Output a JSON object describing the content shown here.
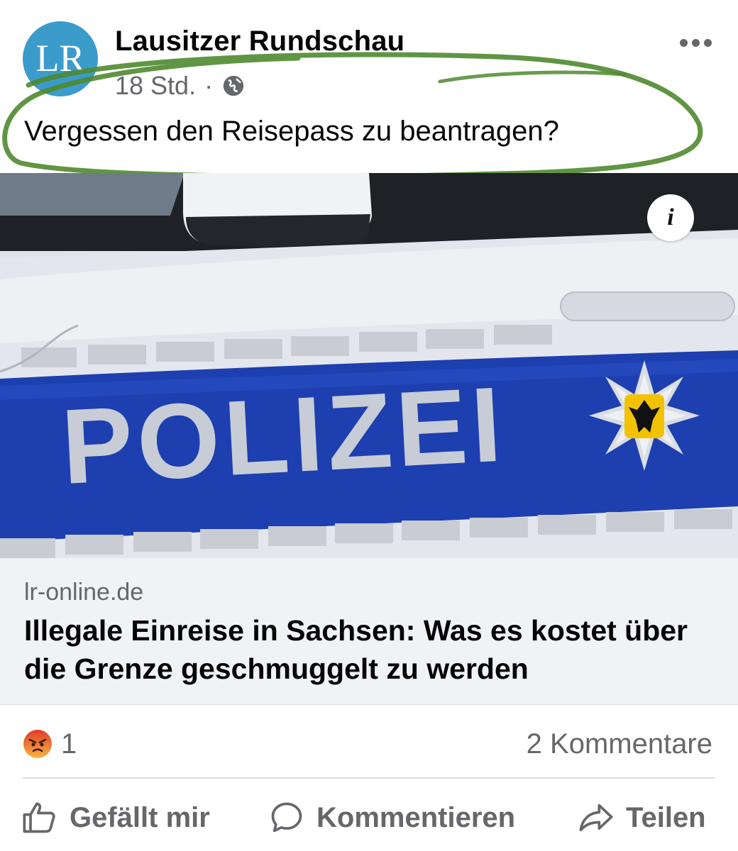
{
  "post": {
    "page_name": "Lausitzer Rundschau",
    "avatar_text": "LR",
    "time": "18 Std.",
    "separator": "·",
    "audience_icon": "globe-icon",
    "more_icon": "more-options-icon",
    "text": "Vergessen den Reisepass zu beantragen?",
    "annotation_color": "#4f8a2f"
  },
  "media": {
    "image_text": "POLIZEI",
    "info_label": "i",
    "colors": {
      "door_white": "#e9ecf1",
      "stripe_blue": "#1d3fb0",
      "reflector": "#c9ccd2"
    }
  },
  "link": {
    "domain": "lr-online.de",
    "headline": "Illegale Einreise in Sachsen: Was es kostet über die Grenze geschmuggelt zu werden"
  },
  "reactions": {
    "emoji": "angry-reaction-icon",
    "count": "1",
    "comments": "2 Kommentare"
  },
  "actions": {
    "like": "Gefällt mir",
    "comment": "Kommentieren",
    "share": "Teilen"
  }
}
